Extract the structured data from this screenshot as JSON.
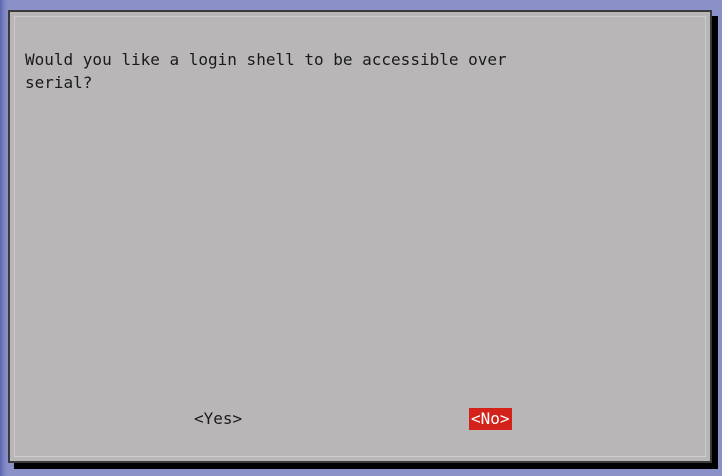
{
  "dialog": {
    "prompt_line1": "Would you like a login shell to be accessible over",
    "prompt_line2": "serial?",
    "buttons": {
      "yes_label": "<Yes>",
      "no_label": "<No>",
      "selected": "no"
    }
  },
  "colors": {
    "background": "#7a82c4",
    "dialog": "#b9b6b8",
    "text": "#1a1a1a",
    "selected_button": "#d2221a",
    "selected_text": "#ffffff"
  }
}
